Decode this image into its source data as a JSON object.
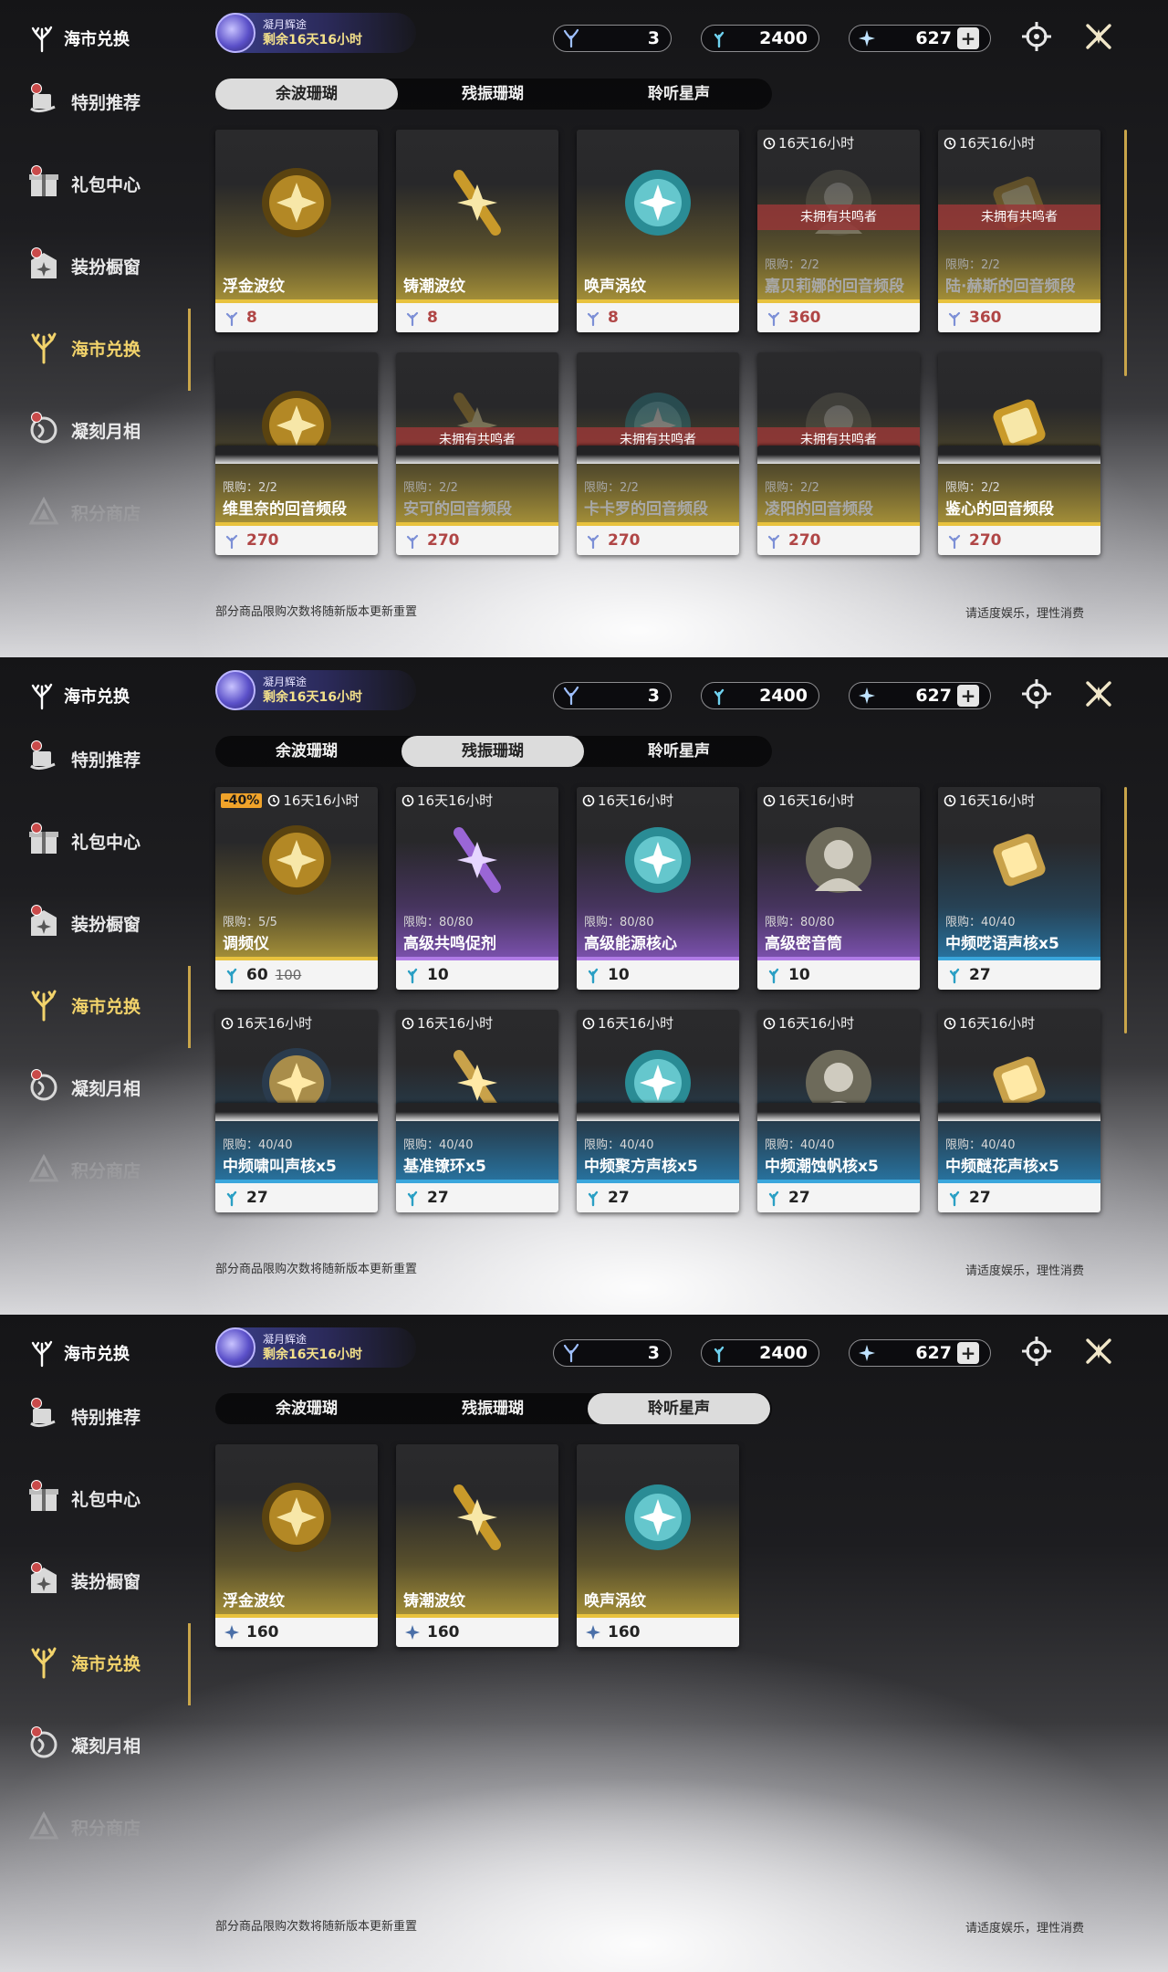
{
  "sidebar": {
    "brand": "海市兑换",
    "items": [
      {
        "label": "特别推荐",
        "icon": "gift-hand-icon",
        "badge": true
      },
      {
        "label": "礼包中心",
        "icon": "gift-box-icon",
        "badge": true
      },
      {
        "label": "装扮橱窗",
        "icon": "wardrobe-icon",
        "badge": true
      },
      {
        "label": "海市兑换",
        "icon": "coral-icon",
        "badge": false,
        "active": true
      },
      {
        "label": "凝刻月相",
        "icon": "moon-icon",
        "badge": true
      },
      {
        "label": "积分商店",
        "icon": "triangle-icon",
        "badge": false,
        "dim": true
      }
    ]
  },
  "event": {
    "title": "凝月辉途",
    "remain": "剩余16天16小时"
  },
  "currency": {
    "a": "3",
    "b": "2400",
    "c": "627",
    "plus": "+"
  },
  "tabs": [
    "余波珊瑚",
    "残振珊瑚",
    "聆听星声"
  ],
  "timer_text": "16天16小时",
  "locked_text": "未拥有共鸣者",
  "footer": {
    "note": "部分商品限购次数将随新版本更新重置",
    "right": "请适度娱乐，理性消费"
  },
  "panel1": {
    "selected_tab": 0,
    "cards": [
      {
        "name": "浮金波纹",
        "price": "8",
        "theme": "gold"
      },
      {
        "name": "铸潮波纹",
        "price": "8",
        "theme": "gold"
      },
      {
        "name": "唤声涡纹",
        "price": "8",
        "theme": "gold"
      },
      {
        "name": "嘉贝莉娜的回音频段",
        "price": "360",
        "theme": "gold",
        "timer": true,
        "limit": "限购：2/2",
        "locked": true
      },
      {
        "name": "陆·赫斯的回音频段",
        "price": "360",
        "theme": "gold",
        "timer": true,
        "limit": "限购：2/2",
        "locked": true
      },
      {
        "name": "维里奈的回音频段",
        "price": "270",
        "theme": "gold",
        "limit": "限购：2/2"
      },
      {
        "name": "安可的回音频段",
        "price": "270",
        "theme": "gold",
        "limit": "限购：2/2",
        "locked": true
      },
      {
        "name": "卡卡罗的回音频段",
        "price": "270",
        "theme": "gold",
        "limit": "限购：2/2",
        "locked": true
      },
      {
        "name": "凌阳的回音频段",
        "price": "270",
        "theme": "gold",
        "limit": "限购：2/2",
        "locked": true
      },
      {
        "name": "鉴心的回音频段",
        "price": "270",
        "theme": "gold",
        "limit": "限购：2/2"
      }
    ]
  },
  "panel2": {
    "selected_tab": 1,
    "cards": [
      {
        "name": "调频仪",
        "price": "60",
        "old_price": "100",
        "discount": "-40%",
        "theme": "gold",
        "timer": true,
        "limit": "限购：5/5"
      },
      {
        "name": "高级共鸣促剂",
        "price": "10",
        "theme": "purple",
        "timer": true,
        "limit": "限购：80/80"
      },
      {
        "name": "高级能源核心",
        "price": "10",
        "theme": "purple",
        "timer": true,
        "limit": "限购：80/80"
      },
      {
        "name": "高级密音筒",
        "price": "10",
        "theme": "purple",
        "timer": true,
        "limit": "限购：80/80"
      },
      {
        "name": "中频呓语声核x5",
        "price": "27",
        "theme": "blue",
        "timer": true,
        "limit": "限购：40/40"
      },
      {
        "name": "中频啸叫声核x5",
        "price": "27",
        "theme": "blue",
        "timer": true,
        "limit": "限购：40/40"
      },
      {
        "name": "基准镣环x5",
        "price": "27",
        "theme": "blue",
        "timer": true,
        "limit": "限购：40/40"
      },
      {
        "name": "中频聚方声核x5",
        "price": "27",
        "theme": "blue",
        "timer": true,
        "limit": "限购：40/40"
      },
      {
        "name": "中频潮蚀帆核x5",
        "price": "27",
        "theme": "blue",
        "timer": true,
        "limit": "限购：40/40"
      },
      {
        "name": "中频醚花声核x5",
        "price": "27",
        "theme": "blue",
        "timer": true,
        "limit": "限购：40/40"
      }
    ]
  },
  "panel3": {
    "selected_tab": 2,
    "cards": [
      {
        "name": "浮金波纹",
        "price": "160",
        "theme": "gold"
      },
      {
        "name": "铸潮波纹",
        "price": "160",
        "theme": "gold"
      },
      {
        "name": "唤声涡纹",
        "price": "160",
        "theme": "gold"
      }
    ]
  },
  "colors": {
    "gold": "#e8c23e",
    "purple": "#b07be6",
    "blue": "#3aa6dc",
    "accent": "#f2d36b",
    "price_red": "#b04646"
  }
}
